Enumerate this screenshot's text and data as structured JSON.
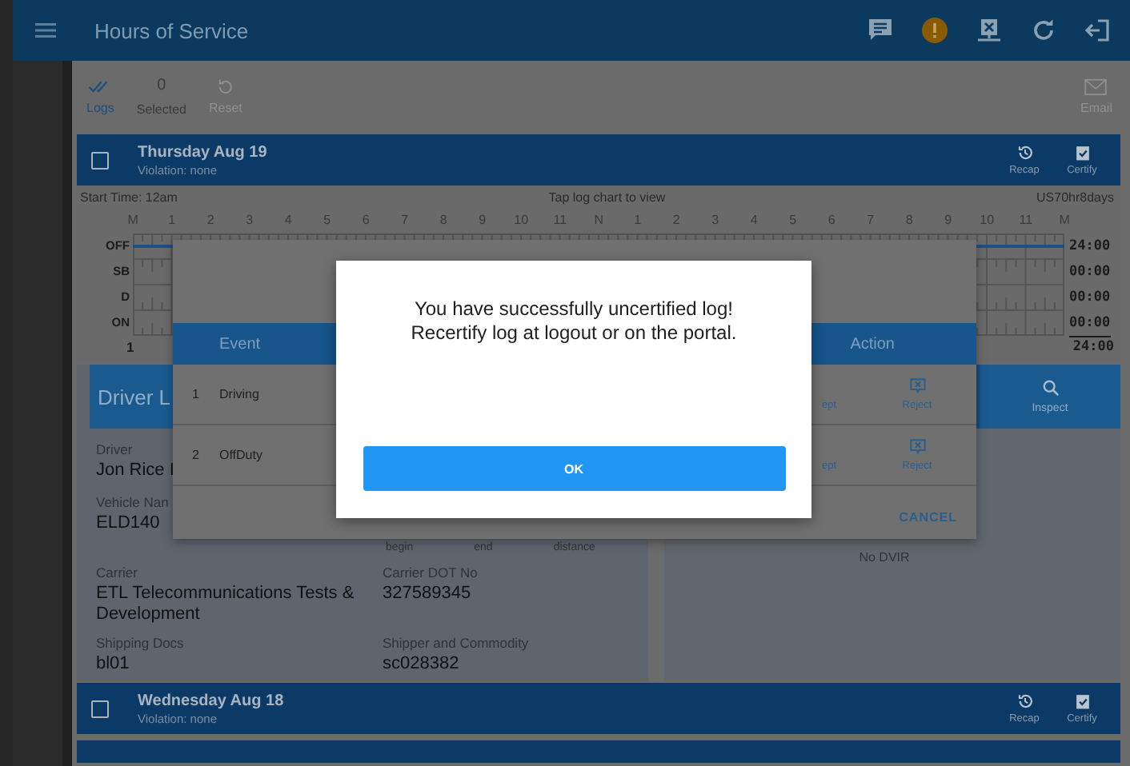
{
  "app_bar": {
    "title": "Hours of Service"
  },
  "toolbar": [
    {
      "kind": "tab",
      "label": "Logs",
      "selected": true
    },
    {
      "kind": "counter",
      "value": "0",
      "label": "Selected"
    },
    {
      "kind": "action",
      "label": "Reset",
      "disabled": true
    }
  ],
  "email": {
    "label": "Email",
    "disabled": true
  },
  "days": [
    {
      "title": "Thursday Aug 19",
      "violation": "Violation: none",
      "checked": false,
      "actions": [
        "Recap",
        "Certify"
      ]
    },
    {
      "title": "Wednesday Aug 18",
      "violation": "Violation: none",
      "checked": false,
      "actions": [
        "Recap",
        "Certify"
      ]
    }
  ],
  "log": {
    "start_time": "Start Time: 12am",
    "hint": "Tap log chart to view",
    "rule": "US70hr8days",
    "hours": [
      "M",
      "1",
      "2",
      "3",
      "4",
      "5",
      "6",
      "7",
      "8",
      "9",
      "10",
      "11",
      "N",
      "1",
      "2",
      "3",
      "4",
      "5",
      "6",
      "7",
      "8",
      "9",
      "10",
      "11",
      "M"
    ],
    "rows": [
      {
        "label": "OFF",
        "total": "24:00"
      },
      {
        "label": "SB",
        "total": "00:00"
      },
      {
        "label": "D",
        "total": "00:00"
      },
      {
        "label": "ON",
        "total": "00:00"
      }
    ],
    "below": "1",
    "grand_total": "24:00"
  },
  "driver_panel": {
    "tab": "Driver L",
    "fields": [
      {
        "label": "Driver",
        "value": "Jon Rice I"
      },
      {
        "label": "Vehicle Nan",
        "value": "ELD140"
      }
    ],
    "columns": [
      "begin",
      "end",
      "distance"
    ],
    "details": [
      {
        "label": "Carrier",
        "value": "ETL Telecommunications Tests & Development"
      },
      {
        "label": "Carrier DOT No",
        "value": "327589345"
      },
      {
        "label": "Shipping Docs",
        "value": "bl01"
      },
      {
        "label": "Shipper and Commodity",
        "value": "sc028382"
      }
    ]
  },
  "dvir_panel": {
    "inspect": "Inspect",
    "empty": "No DVIR"
  },
  "events_dialog": {
    "columns": [
      "Event",
      "Action"
    ],
    "rows": [
      {
        "number": "1",
        "event": "Driving",
        "actions": [
          "ept",
          "Reject"
        ]
      },
      {
        "number": "2",
        "event": "OffDuty",
        "actions": [
          "ept",
          "Reject"
        ]
      }
    ],
    "cancel": "CANCEL"
  },
  "alert": {
    "message": "You have successfully uncertified log!\nRecertify log at logout or on the portal.",
    "button": "OK"
  }
}
